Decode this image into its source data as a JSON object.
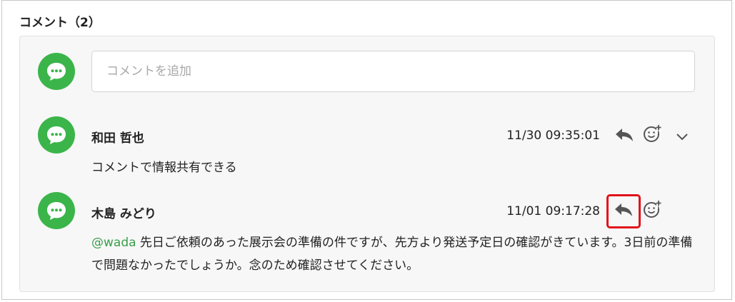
{
  "section": {
    "title": "コメント（2）"
  },
  "composer": {
    "placeholder": "コメントを追加",
    "avatar_icon": "chat-bubble-icon"
  },
  "comments": [
    {
      "author": "和田 哲也",
      "timestamp": "11/30 09:35:01",
      "text": "コメントで情報共有できる",
      "actions": [
        "reply-icon",
        "add-reaction-icon",
        "chevron-down-icon"
      ]
    },
    {
      "author": "木島 みどり",
      "timestamp": "11/01 09:17:28",
      "mention": "@wada",
      "text": " 先日ご依頼のあった展示会の準備の件ですが、先方より発送予定日の確認がきています。3日前の準備で問題なかったでしょうか。念のため確認させてください。",
      "actions": [
        "reply-icon",
        "add-reaction-icon"
      ]
    }
  ],
  "colors": {
    "avatar": "#3bb54a",
    "mention": "#3a9e4a",
    "highlight": "#e0121a",
    "icon": "#555555"
  }
}
